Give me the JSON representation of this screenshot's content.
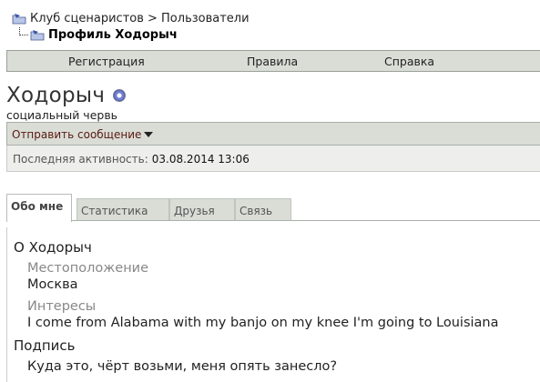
{
  "breadcrumb": {
    "parent": "Клуб сценаристов > Пользователи",
    "current": "Профиль Ходорыч"
  },
  "navbar": {
    "items": [
      "Регистрация",
      "Правила",
      "Справка"
    ]
  },
  "profile": {
    "username": "Ходорыч",
    "usertitle": "социальный червь",
    "send_message": "Отправить сообщение",
    "last_activity_label": "Последняя активность:",
    "last_activity_value": "03.08.2014 13:06"
  },
  "tabs": [
    "Обо мне",
    "Статистика",
    "Друзья",
    "Связь"
  ],
  "about": {
    "title": "О Ходорыч",
    "location_label": "Местоположение",
    "location_value": "Москва",
    "interests_label": "Интересы",
    "interests_value": "I come from Alabama with my banjo on my knee I'm going to Louisiana",
    "signature_title": "Подпись",
    "signature_value": "Куда это, чёрт возьми, меня опять занесло?"
  },
  "colors": {
    "bar_bg": "#d9ddd6",
    "send_message": "#5a1a12"
  }
}
